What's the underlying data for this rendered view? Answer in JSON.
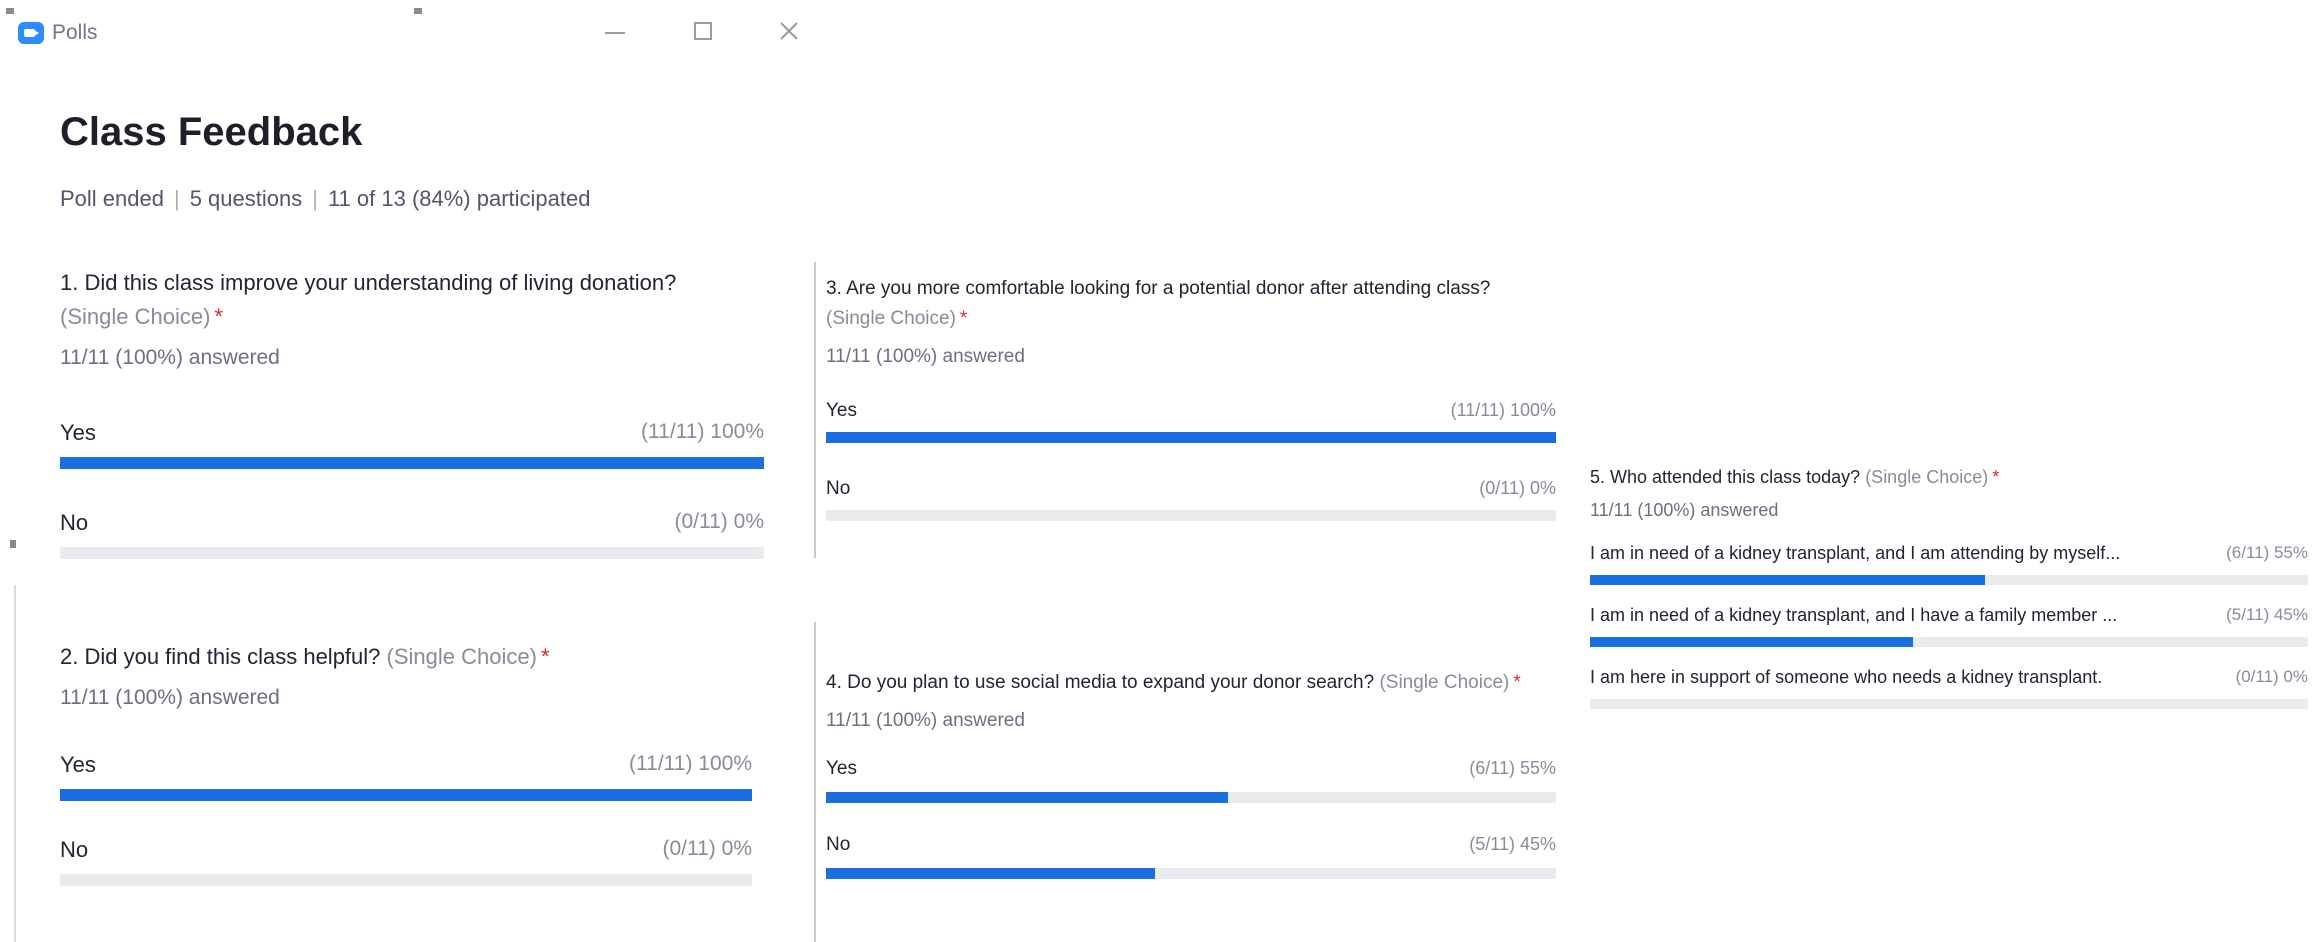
{
  "window": {
    "title": "Polls"
  },
  "poll": {
    "title": "Class Feedback",
    "status": "Poll ended",
    "question_count": "5 questions",
    "participation": "11 of 13 (84%) participated"
  },
  "colors": {
    "bar_fill": "#1a6fe0",
    "bar_track": "#ebebef",
    "required": "#e02828",
    "app_icon": "#2d8cff"
  },
  "questions": [
    {
      "text": "1. Did this class improve your understanding of living donation?",
      "type": "(Single Choice)",
      "required": "*",
      "answered": "11/11 (100%) answered",
      "options": [
        {
          "label": "Yes",
          "result": "(11/11) 100%",
          "fraction": 1.0
        },
        {
          "label": "No",
          "result": "(0/11) 0%",
          "fraction": 0.0
        }
      ]
    },
    {
      "text": "2. Did you find this class helpful?",
      "type": "(Single Choice)",
      "required": "*",
      "answered": "11/11 (100%) answered",
      "options": [
        {
          "label": "Yes",
          "result": "(11/11) 100%",
          "fraction": 1.0
        },
        {
          "label": "No",
          "result": "(0/11) 0%",
          "fraction": 0.0
        }
      ]
    },
    {
      "text": "3. Are you more comfortable looking for a potential donor after attending class?",
      "type": "(Single Choice)",
      "required": "*",
      "answered": "11/11 (100%) answered",
      "options": [
        {
          "label": "Yes",
          "result": "(11/11) 100%",
          "fraction": 1.0
        },
        {
          "label": "No",
          "result": "(0/11) 0%",
          "fraction": 0.0
        }
      ]
    },
    {
      "text": "4. Do you plan to use social media to expand your donor search?",
      "type": "(Single Choice)",
      "required": "*",
      "answered": "11/11 (100%) answered",
      "options": [
        {
          "label": "Yes",
          "result": "(6/11) 55%",
          "fraction": 0.55
        },
        {
          "label": "No",
          "result": "(5/11) 45%",
          "fraction": 0.45
        }
      ]
    },
    {
      "text": "5. Who attended this class today?",
      "type": "(Single Choice)",
      "required": "*",
      "answered": "11/11 (100%) answered",
      "options": [
        {
          "label": "I am in need of a kidney transplant, and I am attending by myself...",
          "result": "(6/11) 55%",
          "fraction": 0.55
        },
        {
          "label": "I am in need of a kidney transplant, and I have a family member ...",
          "result": "(5/11) 45%",
          "fraction": 0.45
        },
        {
          "label": "I am here in support of someone who needs a kidney transplant.",
          "result": "(0/11) 0%",
          "fraction": 0.0
        }
      ]
    }
  ]
}
